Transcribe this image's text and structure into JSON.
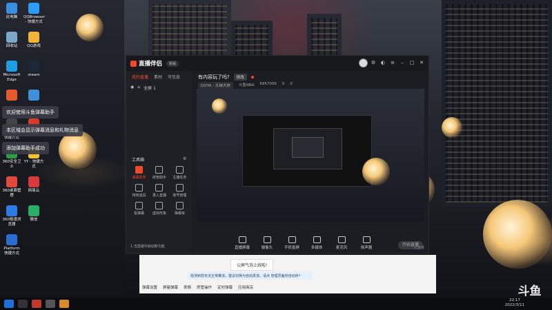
{
  "desktop": {
    "icons": [
      {
        "label": "此电脑",
        "color": "#3a8fe0"
      },
      {
        "label": "QQBrowser - 快捷方式",
        "color": "#2a9df4"
      },
      {
        "label": "回收站",
        "color": "#7aa8c8"
      },
      {
        "label": "QQ游戏",
        "color": "#f2b53a"
      },
      {
        "label": "Microsoft Edge",
        "color": "#1f9de0"
      },
      {
        "label": "steam",
        "color": "#1b2838"
      },
      {
        "label": "",
        "color": "#e45a2a"
      },
      {
        "label": "",
        "color": "#3e90d8"
      },
      {
        "label": "TTLoader 快捷方式",
        "color": "#444"
      },
      {
        "label": "WPS",
        "color": "#d83b2a"
      },
      {
        "label": "360安全卫士",
        "color": "#2ea043"
      },
      {
        "label": "YY - 快捷方式",
        "color": "#f4c430"
      },
      {
        "label": "360桌面管理",
        "color": "#e04a3a"
      },
      {
        "label": "网易云",
        "color": "#d63a3a"
      },
      {
        "label": "360极速浏览器",
        "color": "#2c7be5"
      },
      {
        "label": "微信",
        "color": "#2aae67"
      },
      {
        "label": "Platform 快捷方式",
        "color": "#2a6fd0"
      }
    ]
  },
  "notifications": [
    "欢迎使用斗鱼弹幕助手",
    "本区域会显示弹幕消息和礼物消息",
    "添加弹幕助手成功"
  ],
  "app": {
    "title": "直播伴侣",
    "version_badge": "新版",
    "left_tabs": [
      "我的直播",
      "素材",
      "可信息"
    ],
    "scene_label": "全屏 1",
    "tools_title": "工具箱",
    "tools": [
      {
        "label": "弹幕助手",
        "active": true
      },
      {
        "label": "房管助手",
        "active": false
      },
      {
        "label": "主播任务",
        "active": false
      },
      {
        "label": "特效道具",
        "active": false
      },
      {
        "label": "录入直播",
        "active": false
      },
      {
        "label": "账号管理",
        "active": false
      },
      {
        "label": "投弹幕",
        "active": false
      },
      {
        "label": "虚拟形象",
        "active": false
      },
      {
        "label": "弹幕库",
        "active": false
      }
    ],
    "left_footer": "1.当直播中启动新功能",
    "room_title": "有内容玩了吗?",
    "room_chip": "修改",
    "room_category": "DOTA - 天梯大神",
    "room_meta": [
      "斗鱼NBA",
      "6957006",
      "0",
      "0"
    ],
    "controls": [
      "直播屏幕",
      "摄像头",
      "手机投屏",
      "多媒体",
      "麦克风",
      "扬声器"
    ],
    "start_button": "开始直播",
    "status_line": "已连接"
  },
  "strip": {
    "pill": "公屏气泡上线啦!",
    "tip": "检测到您无法正常推流，建议切换为自动发流，请点 管理员备份自动存?",
    "bottom": [
      "弹幕设置",
      "屏蔽弹幕",
      "表情",
      "房管操作",
      "定时弹幕",
      "应用商店"
    ]
  },
  "taskbar": {
    "time": "22:17",
    "date": "2022/3/11"
  },
  "watermark": {
    "brand": "斗鱼",
    "domain": "DOUYU.COM"
  }
}
